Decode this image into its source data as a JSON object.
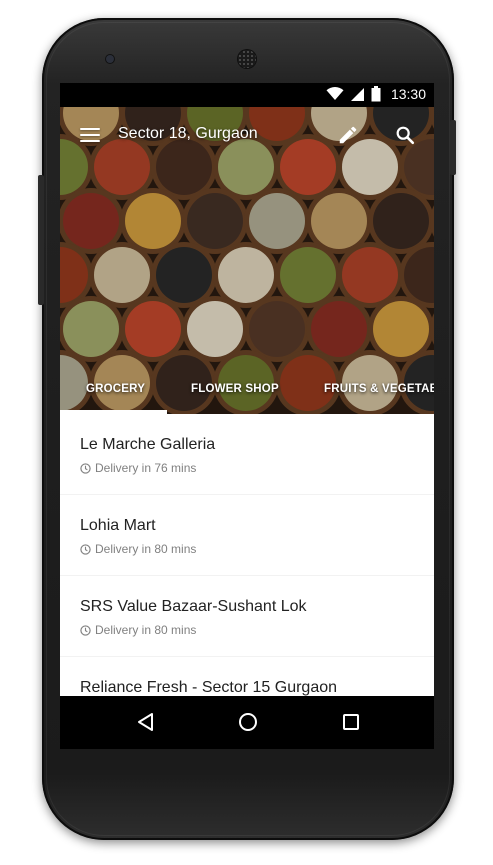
{
  "status_bar": {
    "time": "13:30",
    "icons": [
      "wifi-icon",
      "signal-icon",
      "battery-icon"
    ]
  },
  "app_bar": {
    "location": "Sector 18, Gurgaon",
    "icons": [
      "menu-icon",
      "edit-icon",
      "search-icon"
    ]
  },
  "tabs": [
    {
      "label": "GROCERY",
      "selected": true
    },
    {
      "label": "FLOWER SHOP",
      "selected": false
    },
    {
      "label": "FRUITS & VEGETAB",
      "selected": false
    }
  ],
  "stores": [
    {
      "name": "Le Marche Galleria",
      "delivery": "Delivery in 76 mins"
    },
    {
      "name": "Lohia Mart",
      "delivery": "Delivery in 80 mins"
    },
    {
      "name": "SRS Value Bazaar-Sushant Lok",
      "delivery": "Delivery in 80 mins"
    },
    {
      "name": "Reliance Fresh - Sector 15 Gurgaon",
      "delivery": ""
    }
  ],
  "nav_bar": {
    "icons": [
      "back-icon",
      "home-icon",
      "recents-icon"
    ]
  },
  "colors": {
    "accent": "#ffffff",
    "list_background": "#f2f2f2",
    "divider": "#e6e6e6",
    "secondary_text": "#808080"
  }
}
